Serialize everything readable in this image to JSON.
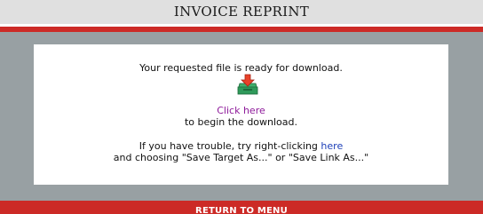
{
  "header": {
    "title": "INVOICE REPRINT"
  },
  "content": {
    "ready_message": "Your requested file is ready for download.",
    "download_icon": "download-tray-icon",
    "click_here_label": "Click here",
    "begin_download_text": "to begin the download.",
    "trouble_prefix": "If you have trouble, try right-clicking ",
    "here_link_label": "here",
    "save_instructions": "and choosing \"Save Target As...\" or \"Save Link As...\""
  },
  "footer": {
    "return_label": "RETURN TO MENU"
  },
  "colors": {
    "header_bg": "#e0e0e0",
    "accent_red": "#cc2a26",
    "frame_gray": "#98a0a3",
    "link_purple": "#8e1a9a",
    "link_blue": "#1d3fb8",
    "icon_green": "#2f9a5a",
    "icon_arrow": "#e8412a"
  }
}
